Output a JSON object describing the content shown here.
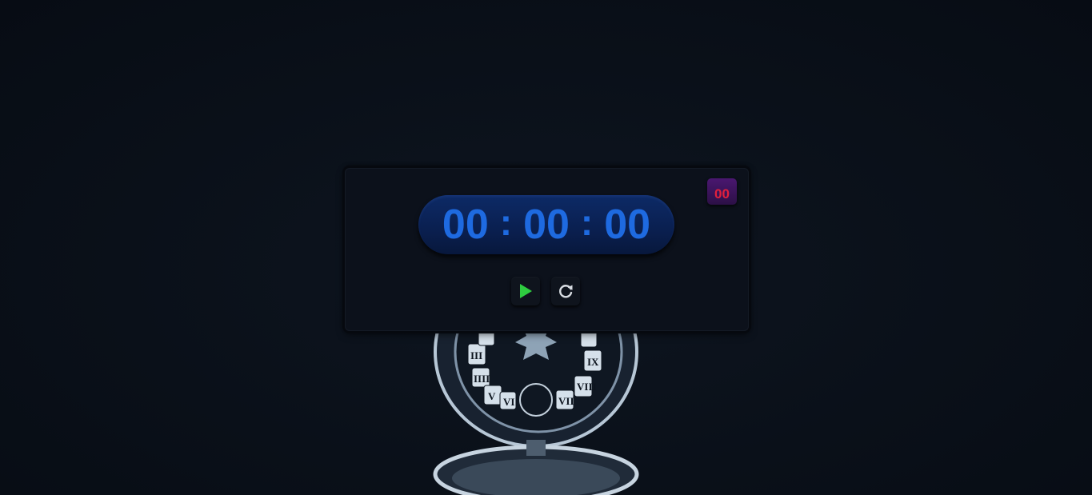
{
  "timer": {
    "hours": "00",
    "minutes": "00",
    "seconds": "00",
    "separator": ":",
    "milliseconds": "00"
  },
  "controls": {
    "play_icon": "play-icon",
    "reset_icon": "reset-icon"
  },
  "colors": {
    "time_text": "#1e6ae0",
    "milliseconds_text": "#e0203c",
    "play_icon": "#2ecc40",
    "reset_icon": "#d9dde3",
    "background": "#0b1018"
  }
}
